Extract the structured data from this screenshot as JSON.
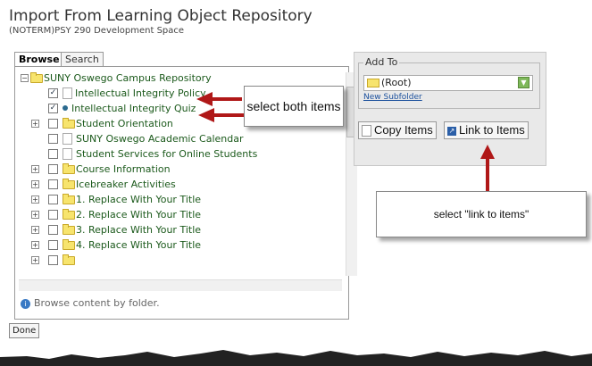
{
  "header": {
    "title": "Import From Learning Object Repository",
    "subtitle": "(NOTERM)PSY 290 Development Space"
  },
  "tabs": [
    "Browse",
    "Search"
  ],
  "tree": {
    "root": "SUNY Oswego Campus Repository",
    "items": [
      {
        "label": "Intellectual Integrity Policy",
        "checked": true
      },
      {
        "label": "Intellectual Integrity Quiz",
        "checked": true
      },
      {
        "label": "Student Orientation"
      },
      {
        "label": "SUNY Oswego Academic Calendar"
      },
      {
        "label": "Student Services for Online Students"
      },
      {
        "label": "Course Information"
      },
      {
        "label": "Icebreaker Activities"
      },
      {
        "label": "1. Replace With Your Title"
      },
      {
        "label": "2. Replace With Your Title"
      },
      {
        "label": "3. Replace With Your Title"
      },
      {
        "label": "4. Replace With Your Title"
      }
    ],
    "hint": "Browse content by folder."
  },
  "add_to": {
    "legend": "Add To",
    "selected": "(Root)",
    "new_subfolder": "New Subfolder"
  },
  "buttons": {
    "copy": "Copy Items",
    "link": "Link to Items",
    "done": "Done"
  },
  "callouts": {
    "select_both": "select both items",
    "select_link": "select \"link to items\""
  },
  "colors": {
    "arrow": "#b01818",
    "tree_text": "#1c5a1c",
    "link": "#1a4f9c"
  }
}
